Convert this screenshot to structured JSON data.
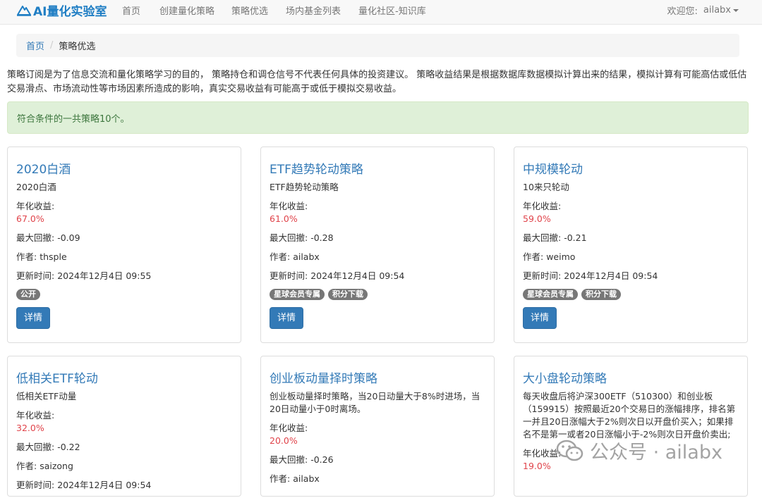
{
  "navbar": {
    "brand": "AI量化实验室",
    "links": [
      "首页",
      "创建量化策略",
      "策略优选",
      "场内基金列表",
      "量化社区-知识库"
    ],
    "user_greeting": "欢迎您:",
    "username": "ailabx"
  },
  "breadcrumb": {
    "home": "首页",
    "current": "策略优选"
  },
  "disclaimer": "策略订阅是为了信息交流和量化策略学习的目的， 策略持仓和调仓信号不代表任何具体的投资建议。 策略收益结果是根据数据库数据模拟计算出来的结果，模拟计算有可能高估或低估交易滑点、市场流动性等市场因素所造成的影响，真实交易收益有可能高于或低于模拟交易收益。",
  "alert": "符合条件的一共策略10个。",
  "labels": {
    "annual_return": "年化收益:",
    "max_drawdown": "最大回撤:",
    "author": "作者:",
    "updated": "更新时间:",
    "details_button": "详情"
  },
  "strategies": [
    {
      "title": "2020白酒",
      "description": "2020白酒",
      "annual_return": "67.0%",
      "max_drawdown": "-0.09",
      "author": "thsple",
      "updated": "2024年12月4日 09:55",
      "tags": [
        "公开"
      ]
    },
    {
      "title": "ETF趋势轮动策略",
      "description": "ETF趋势轮动策略",
      "annual_return": "61.0%",
      "max_drawdown": "-0.28",
      "author": "ailabx",
      "updated": "2024年12月4日 09:54",
      "tags": [
        "星球会员专属",
        "积分下载"
      ]
    },
    {
      "title": "中规模轮动",
      "description": "10来只轮动",
      "annual_return": "59.0%",
      "max_drawdown": "-0.21",
      "author": "weimo",
      "updated": "2024年12月4日 09:54",
      "tags": [
        "星球会员专属",
        "积分下载"
      ]
    },
    {
      "title": "低相关ETF轮动",
      "description": "低相关ETF动量",
      "annual_return": "32.0%",
      "max_drawdown": "-0.22",
      "author": "saizong",
      "updated": "2024年12月4日 09:54",
      "tags": []
    },
    {
      "title": "创业板动量择时策略",
      "description": "创业板动量择时策略，当20日动量大于8%时进场，当20日动量小于0时离场。",
      "annual_return": "20.0%",
      "max_drawdown": "-0.26",
      "author": "ailabx",
      "updated": "",
      "tags": []
    },
    {
      "title": "大小盘轮动策略",
      "description": "每天收盘后将沪深300ETF（510300）和创业板（159915）按照最近20个交易日的涨幅排序，排名第一并且20日涨幅大于2%则次日以开盘价买入；如果排名不是第一或者20日涨幅小于-2%则次日开盘价卖出;",
      "annual_return": "19.0%",
      "max_drawdown": "",
      "author": "",
      "updated": "",
      "tags": []
    }
  ],
  "watermark": "公众号 · ailabx"
}
